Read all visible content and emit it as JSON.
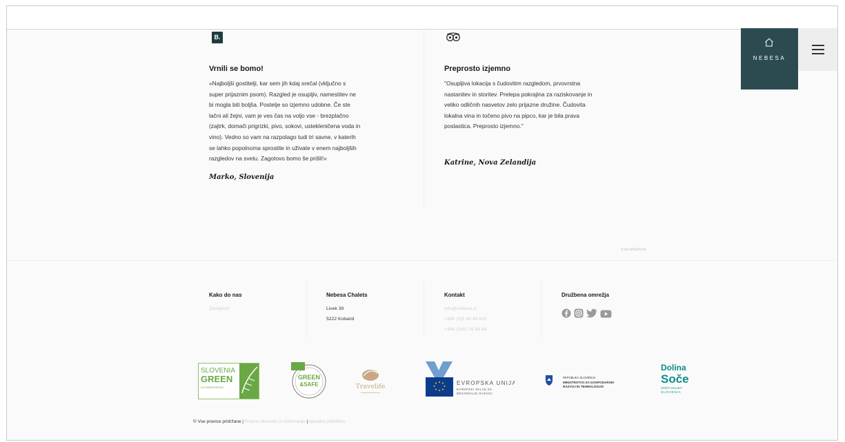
{
  "reviews": [
    {
      "source_icon": "booking-icon",
      "badge_letter": "B.",
      "title": "Vrnili se bomo!",
      "lines": [
        "»Najboljši gostitelji, kar sem jih kdaj srečal (vključno s",
        "super prijaznim psom). Razgled je osupljiv, namestitev ne",
        "bi mogla biti boljša. Postelje so izjemno udobne. Če ste",
        "lačni ali žejni, vam je ves čas na voljo vse - brezplačno",
        "(zajtrk, domači prigrizki, pivo, sokovi, ustekleničena voda in",
        "vino). Vedno so vam na razpolago tudi tri savne, v katerih",
        "se lahko popolnoma sprostite in uživate v enem najboljših",
        "razgledov na svetu. Zagotovo bomo še prišli!«"
      ],
      "author": "Marko, Slovenija"
    },
    {
      "source_icon": "tripadvisor-owl-icon",
      "title": "Preprosto izjemno",
      "lines": [
        "\"Osupljiva lokacija s čudovitim razgledom, prvovrstna",
        "nastanitev in storitev. Prelepa pokrajina za raziskovanje in",
        "veliko odličnih nasvetov zelo prijazne družine. Čudovita",
        "lokalna vina in točeno pivo na pipco, kar je bila prava",
        "poslastica. Preprosto izjemno.\""
      ],
      "author": "Katrine, Nova Zelandija"
    }
  ],
  "all_reviews_link": "VSA MNENJA",
  "logo": {
    "brand": "NEBESA",
    "icon": "house-icon"
  },
  "menu": {
    "icon": "hamburger-menu-icon"
  },
  "footer": {
    "columns": [
      {
        "title": "Kako do nas",
        "items": [
          "Zemljevid"
        ]
      },
      {
        "title": "Nebesa Chalets",
        "items": [
          "Livek 39",
          "5222 Kobarid"
        ]
      },
      {
        "title": "Kontakt",
        "items": [
          "info@nebesa.si",
          "+386 (0)5 38 44 620",
          "+386 (0)41 76 54 84"
        ]
      },
      {
        "title": "Družbena omrežja",
        "items": []
      }
    ],
    "social_icons": [
      "facebook-icon",
      "instagram-icon",
      "twitter-icon",
      "youtube-icon"
    ]
  },
  "partner_logos": {
    "slovenia_green": {
      "line1a": "SLOVENIA",
      "line1b": "GREEN",
      "line2": "ACCOMMODATION"
    },
    "green_safe": {
      "top": "GREEN",
      "bottom": "&SAFE"
    },
    "travelife": {
      "text": "Travelife"
    },
    "eu": {
      "title": "EVROPSKA UNIJA",
      "sub1": "EVROPSKI SKLAD ZA",
      "sub2": "REGIONALNI RAZVOJ"
    },
    "ministry": {
      "line1": "REPUBLIKA SLOVENIJA",
      "line2": "MINISTRSTVO ZA GOSPODARSKI",
      "line3": "RAZVOJ IN TEHNOLOGIJO"
    },
    "dolina_soce": {
      "line1": "Dolina",
      "line2": "Soče",
      "line3": "SOČA VALLEY",
      "line4": "SLOVENIA"
    }
  },
  "copyright": {
    "text": "© Vse pravice pridržane |",
    "link1": "Pravno obvestilo in informacije",
    "sep": "|",
    "link2": "Uporaba piškotkov"
  },
  "colors": {
    "brand_dark": "#2b4b51",
    "green": "#6aa845",
    "teal": "#0e8c8c"
  }
}
